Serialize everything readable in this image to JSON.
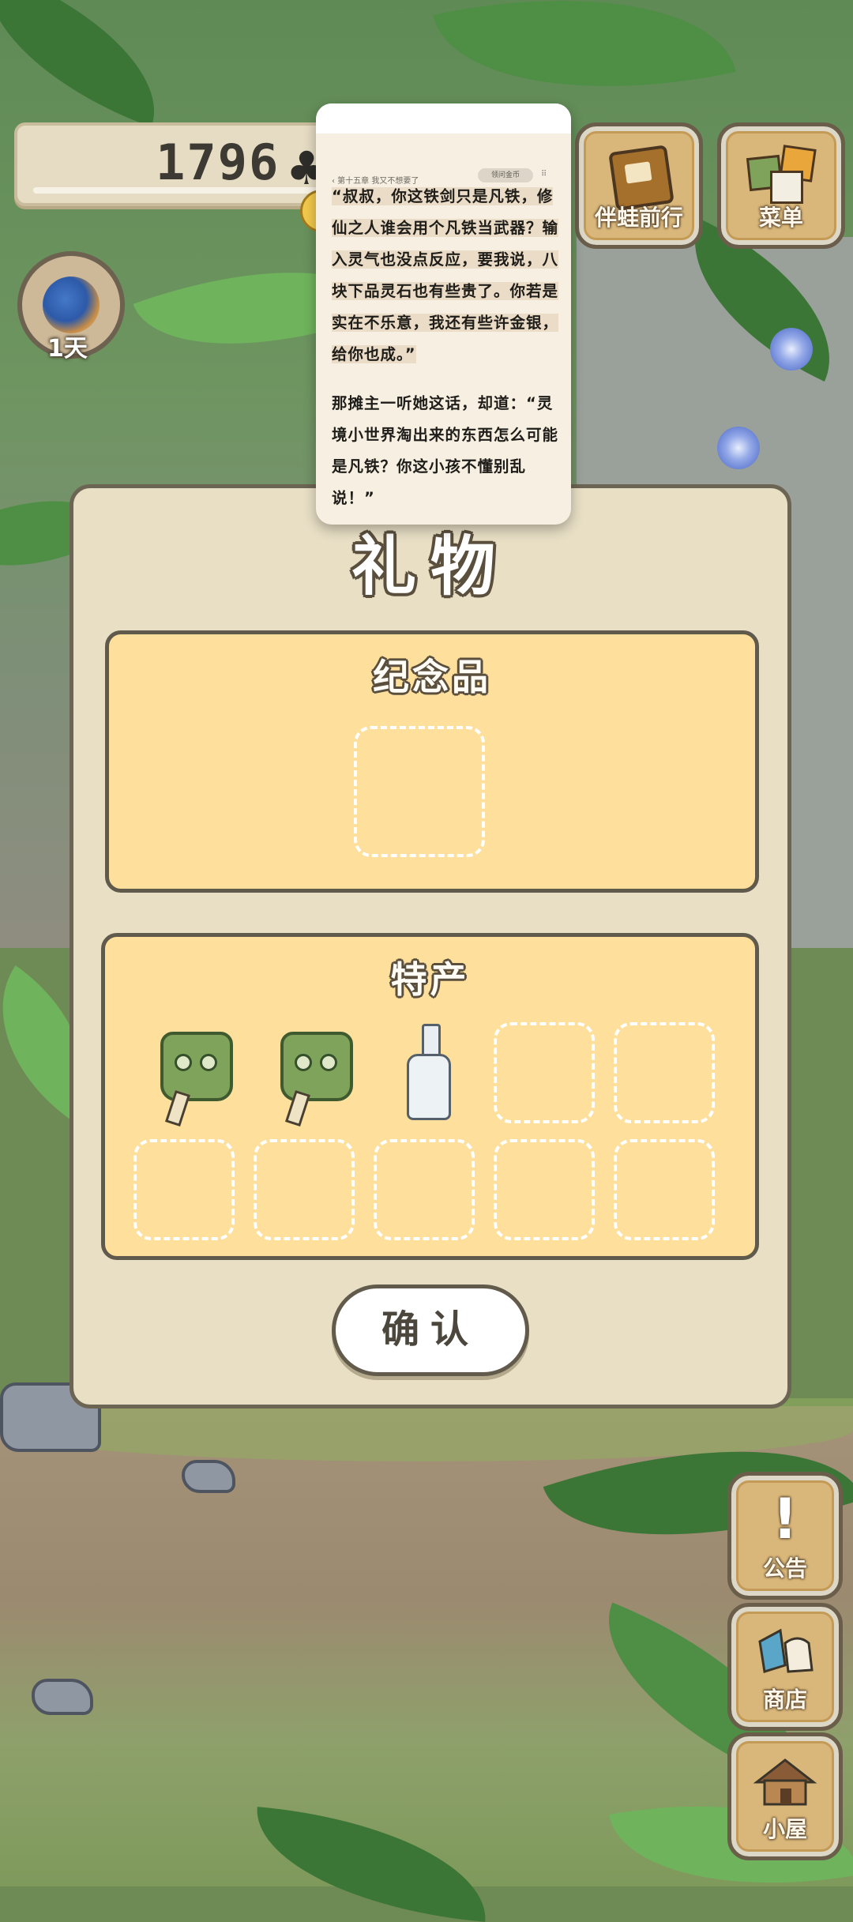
{
  "hud": {
    "clover_count": "1796",
    "clover_icon": "♣",
    "day_label": "1天"
  },
  "top_buttons": {
    "travel_label": "伴蛙前行",
    "menu_label": "菜单"
  },
  "side_buttons": {
    "notice_label": "公告",
    "notice_icon": "!",
    "shop_label": "商店",
    "house_label": "小屋"
  },
  "reader": {
    "chapter_crumb": "‹ 第十五章 我又不想要了",
    "pill_label": "领问金币",
    "grip_icon": "⠿",
    "paragraph_1": "“叔叔，你这铁剑只是凡铁，修仙之人谁会用个凡铁当武器？输入灵气也没点反应，要我说，八块下品灵石也有些贵了。你若是实在不乐意，我还有些许金银，给你也成。”",
    "paragraph_2": "那摊主一听她这话，却道：“灵境小世界淘出来的东西怎么可能是凡铁？你这小孩不懂别乱说！”"
  },
  "gift_panel": {
    "title": "礼物",
    "souvenir_title": "纪念品",
    "specialty_title": "特产",
    "specialty_items": [
      "totem-item",
      "totem-item",
      "bottle-item"
    ],
    "empty_slots": 7,
    "confirm_label": "确认"
  },
  "colors": {
    "panel_bg": "#e8dfc5",
    "section_bg": "#fedf9b",
    "wood": "#d9b77a"
  }
}
